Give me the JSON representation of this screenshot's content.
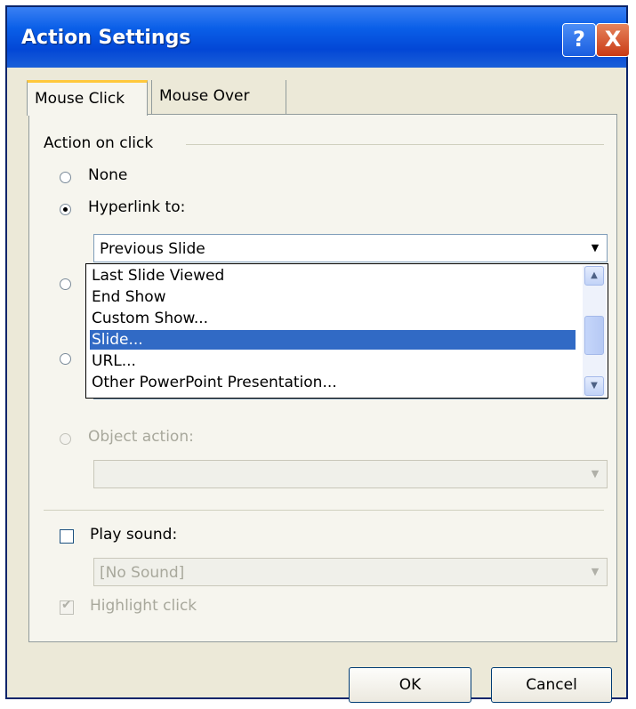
{
  "window": {
    "title": "Action Settings",
    "help_label": "?",
    "close_label": "X"
  },
  "tabs": [
    {
      "label": "Mouse Click",
      "active": true
    },
    {
      "label": "Mouse Over",
      "active": false
    }
  ],
  "action_group": {
    "label": "Action on click",
    "options": {
      "none": "None",
      "hyperlink": "Hyperlink to:",
      "object_action": "Object action:"
    },
    "selected": "hyperlink"
  },
  "hyperlink_combo": {
    "value": "Previous Slide",
    "list": [
      {
        "label": "Last Slide Viewed",
        "selected": false
      },
      {
        "label": "End Show",
        "selected": false
      },
      {
        "label": "Custom Show...",
        "selected": false
      },
      {
        "label": "Slide...",
        "selected": true
      },
      {
        "label": "URL...",
        "selected": false
      },
      {
        "label": "Other PowerPoint Presentation...",
        "selected": false
      }
    ]
  },
  "object_action_combo": {
    "value": ""
  },
  "sound": {
    "label": "Play sound:",
    "checked": false,
    "value": "[No Sound]"
  },
  "highlight": {
    "label": "Highlight click",
    "checked": true,
    "enabled": false
  },
  "buttons": {
    "ok": "OK",
    "cancel": "Cancel"
  },
  "colors": {
    "titlebar": "#0a5fe8",
    "selection": "#316ac5",
    "dialog_bg": "#ece9d8"
  },
  "icons": [
    "help-icon",
    "close-icon",
    "chevron-down-icon",
    "chevron-up-icon",
    "checkmark-icon"
  ]
}
